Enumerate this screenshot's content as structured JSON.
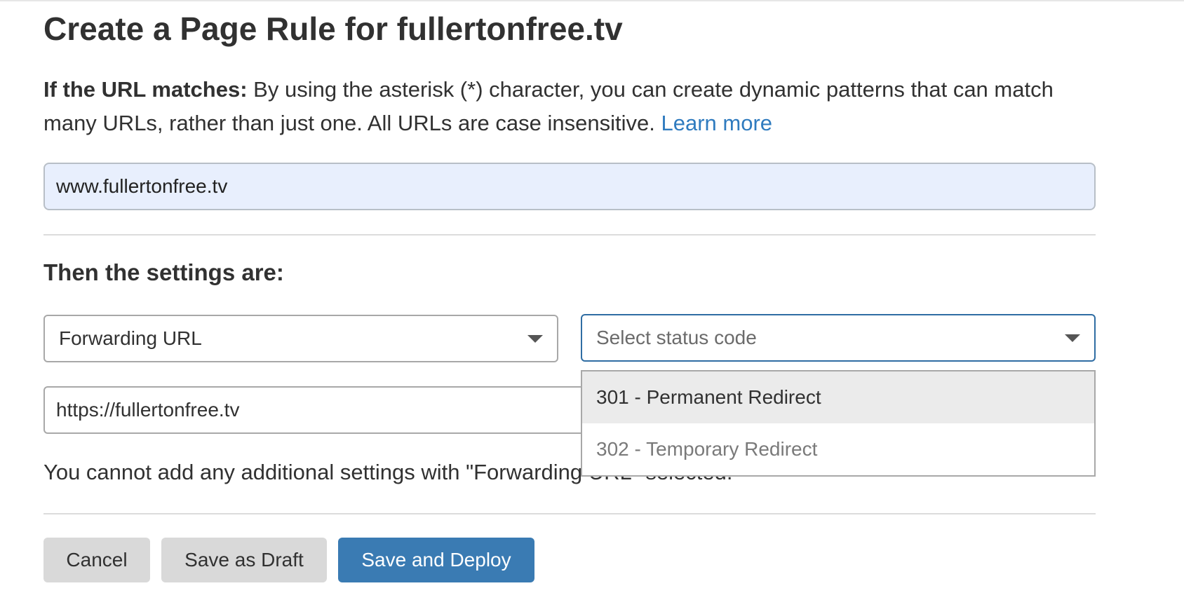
{
  "title": "Create a Page Rule for fullertonfree.tv",
  "url_section": {
    "label": "If the URL matches:",
    "description": "By using the asterisk (*) character, you can create dynamic patterns that can match many URLs, rather than just one. All URLs are case insensitive.",
    "learn_more": "Learn more",
    "url_value": "www.fullertonfree.tv"
  },
  "settings_section": {
    "heading": "Then the settings are:",
    "setting_value": "Forwarding URL",
    "status_placeholder": "Select status code",
    "forward_url_value": "https://fullertonfree.tv",
    "notice": "You cannot add any additional settings with \"Forwarding URL\" selected.",
    "status_options": [
      {
        "label": "301 - Permanent Redirect",
        "highlighted": true
      },
      {
        "label": "302 - Temporary Redirect",
        "highlighted": false
      }
    ]
  },
  "actions": {
    "cancel": "Cancel",
    "save_draft": "Save as Draft",
    "save_deploy": "Save and Deploy"
  },
  "colors": {
    "link": "#2f7bbf",
    "primary_button": "#3a7bb3",
    "url_input_bg": "#e8effd",
    "focus_border": "#2f6da3"
  }
}
